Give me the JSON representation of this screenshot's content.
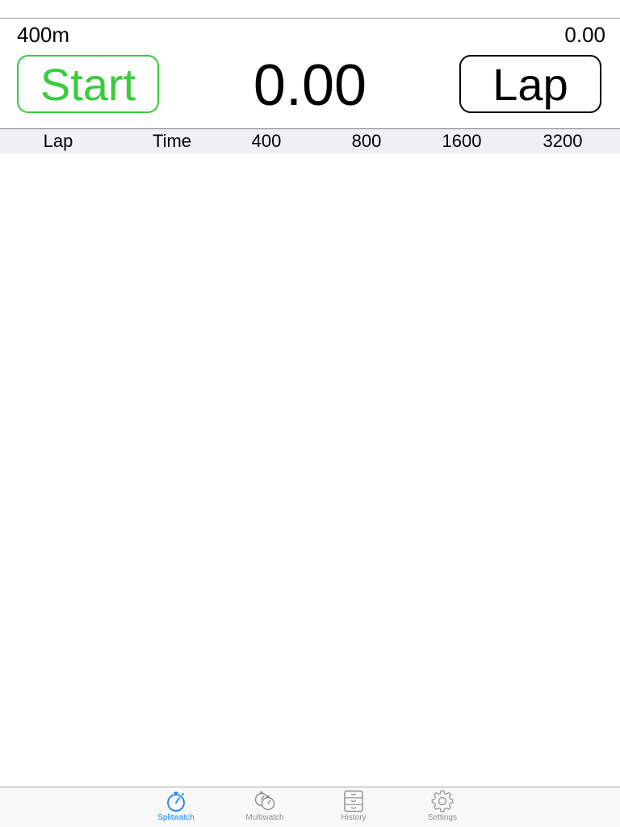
{
  "header": {
    "distance": "400m",
    "split_time": "0.00"
  },
  "controls": {
    "start_label": "Start",
    "lap_label": "Lap",
    "main_time": "0.00"
  },
  "table": {
    "columns": [
      "Lap",
      "Time",
      "400",
      "800",
      "1600",
      "3200"
    ],
    "rows": []
  },
  "tabbar": {
    "tabs": [
      {
        "label": "Splitwatch",
        "icon": "stopwatch-icon",
        "active": true
      },
      {
        "label": "Multiwatch",
        "icon": "multi-stopwatch-icon",
        "active": false
      },
      {
        "label": "History",
        "icon": "file-cabinet-icon",
        "active": false
      },
      {
        "label": "Settings",
        "icon": "gear-icon",
        "active": false
      }
    ]
  },
  "colors": {
    "start_green": "#39cc3b",
    "tab_active_blue": "#1a86f0",
    "tab_inactive_gray": "#8e8e93",
    "column_header_bg": "#efeff4"
  }
}
